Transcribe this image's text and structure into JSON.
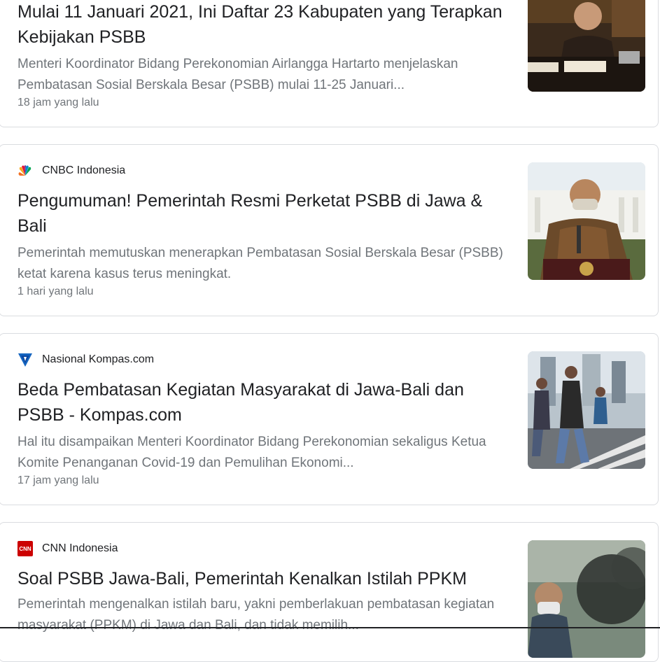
{
  "articles": [
    {
      "title": "Mulai 11 Januari 2021, Ini Daftar 23 Kabupaten yang Terapkan Kebijakan PSBB",
      "snippet": "Menteri Koordinator Bidang Perekonomian Airlangga Hartarto menjelaskan Pembatasan Sosial Berskala Besar (PSBB) mulai 11-25 Januari...",
      "time": "18 jam yang lalu"
    },
    {
      "source": "CNBC Indonesia",
      "title": "Pengumuman! Pemerintah Resmi Perketat PSBB di Jawa & Bali",
      "snippet": "Pemerintah memutuskan menerapkan Pembatasan Sosial Berskala Besar (PSBB) ketat karena kasus terus meningkat.",
      "time": "1 hari yang lalu"
    },
    {
      "source": "Nasional Kompas.com",
      "title": "Beda Pembatasan Kegiatan Masyarakat di Jawa-Bali dan PSBB - Kompas.com",
      "snippet": "Hal itu disampaikan Menteri Koordinator Bidang Perekonomian sekaligus Ketua Komite Penanganan Covid-19 dan Pemulihan Ekonomi...",
      "time": "17 jam yang lalu"
    },
    {
      "source": "CNN Indonesia",
      "title": "Soal PSBB Jawa-Bali, Pemerintah Kenalkan Istilah PPKM",
      "snippet": "Pemerintah mengenalkan istilah baru, yakni pemberlakuan pembatasan kegiatan masyarakat (PPKM) di Jawa dan Bali, dan tidak memilih..."
    }
  ],
  "icons": {
    "cnbc": "peacock-icon",
    "kompas": "kompas-icon",
    "cnn": "cnn-icon"
  },
  "cnn_logo_text": "CNN"
}
